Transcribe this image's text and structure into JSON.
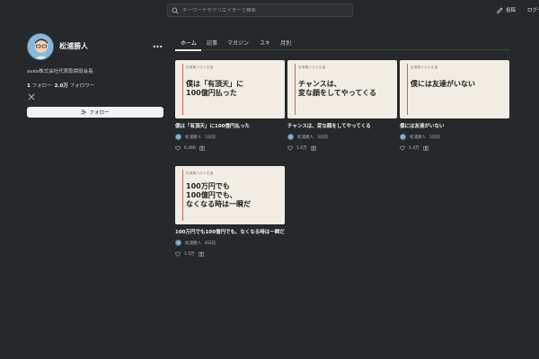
{
  "search": {
    "placeholder": "キーワードやクリエイターで検索"
  },
  "header": {
    "post_label": "投稿",
    "login_label": "ログイ"
  },
  "profile": {
    "name": "松浦勝人",
    "bio": "avex株式会社代表取締役会長",
    "following_count": "1",
    "following_label": "フォロー",
    "followers_count": "2.0万",
    "followers_label": "フォロワー",
    "follow_button": "フォロー",
    "more": "•••"
  },
  "tabs": [
    "ホーム",
    "記事",
    "マガジン",
    "スキ",
    "月別"
  ],
  "articles": [
    {
      "series": "松浦勝人の人生論",
      "headline_1": "僕は「有頂天」に",
      "headline_2": "100億円払った",
      "headline_3": "",
      "title": "僕は「有頂天」に100億円払った",
      "author": "松浦勝人",
      "date": "1日前",
      "likes": "6,466"
    },
    {
      "series": "松浦勝人の人生論",
      "headline_1": "チャンスは、",
      "headline_2": "変な顔をしてやってくる",
      "headline_3": "",
      "title": "チャンスは、変な顔をしてやってくる",
      "author": "松浦勝人",
      "date": "3日前",
      "likes": "1.6万"
    },
    {
      "series": "松浦勝人の人生論",
      "headline_1": "僕には友達がいない",
      "headline_2": "",
      "headline_3": "",
      "title": "僕には友達がいない",
      "author": "松浦勝人",
      "date": "5日前",
      "likes": "1.4万"
    },
    {
      "series": "松浦勝人の人生論",
      "headline_1": "100万円でも",
      "headline_2": "100億円でも、",
      "headline_3": "なくなる時は一瞬だ",
      "title": "100万円でも100億円でも、なくなる時は一瞬だ",
      "author": "松浦勝人",
      "date": "6日前",
      "likes": "1.5万"
    }
  ]
}
